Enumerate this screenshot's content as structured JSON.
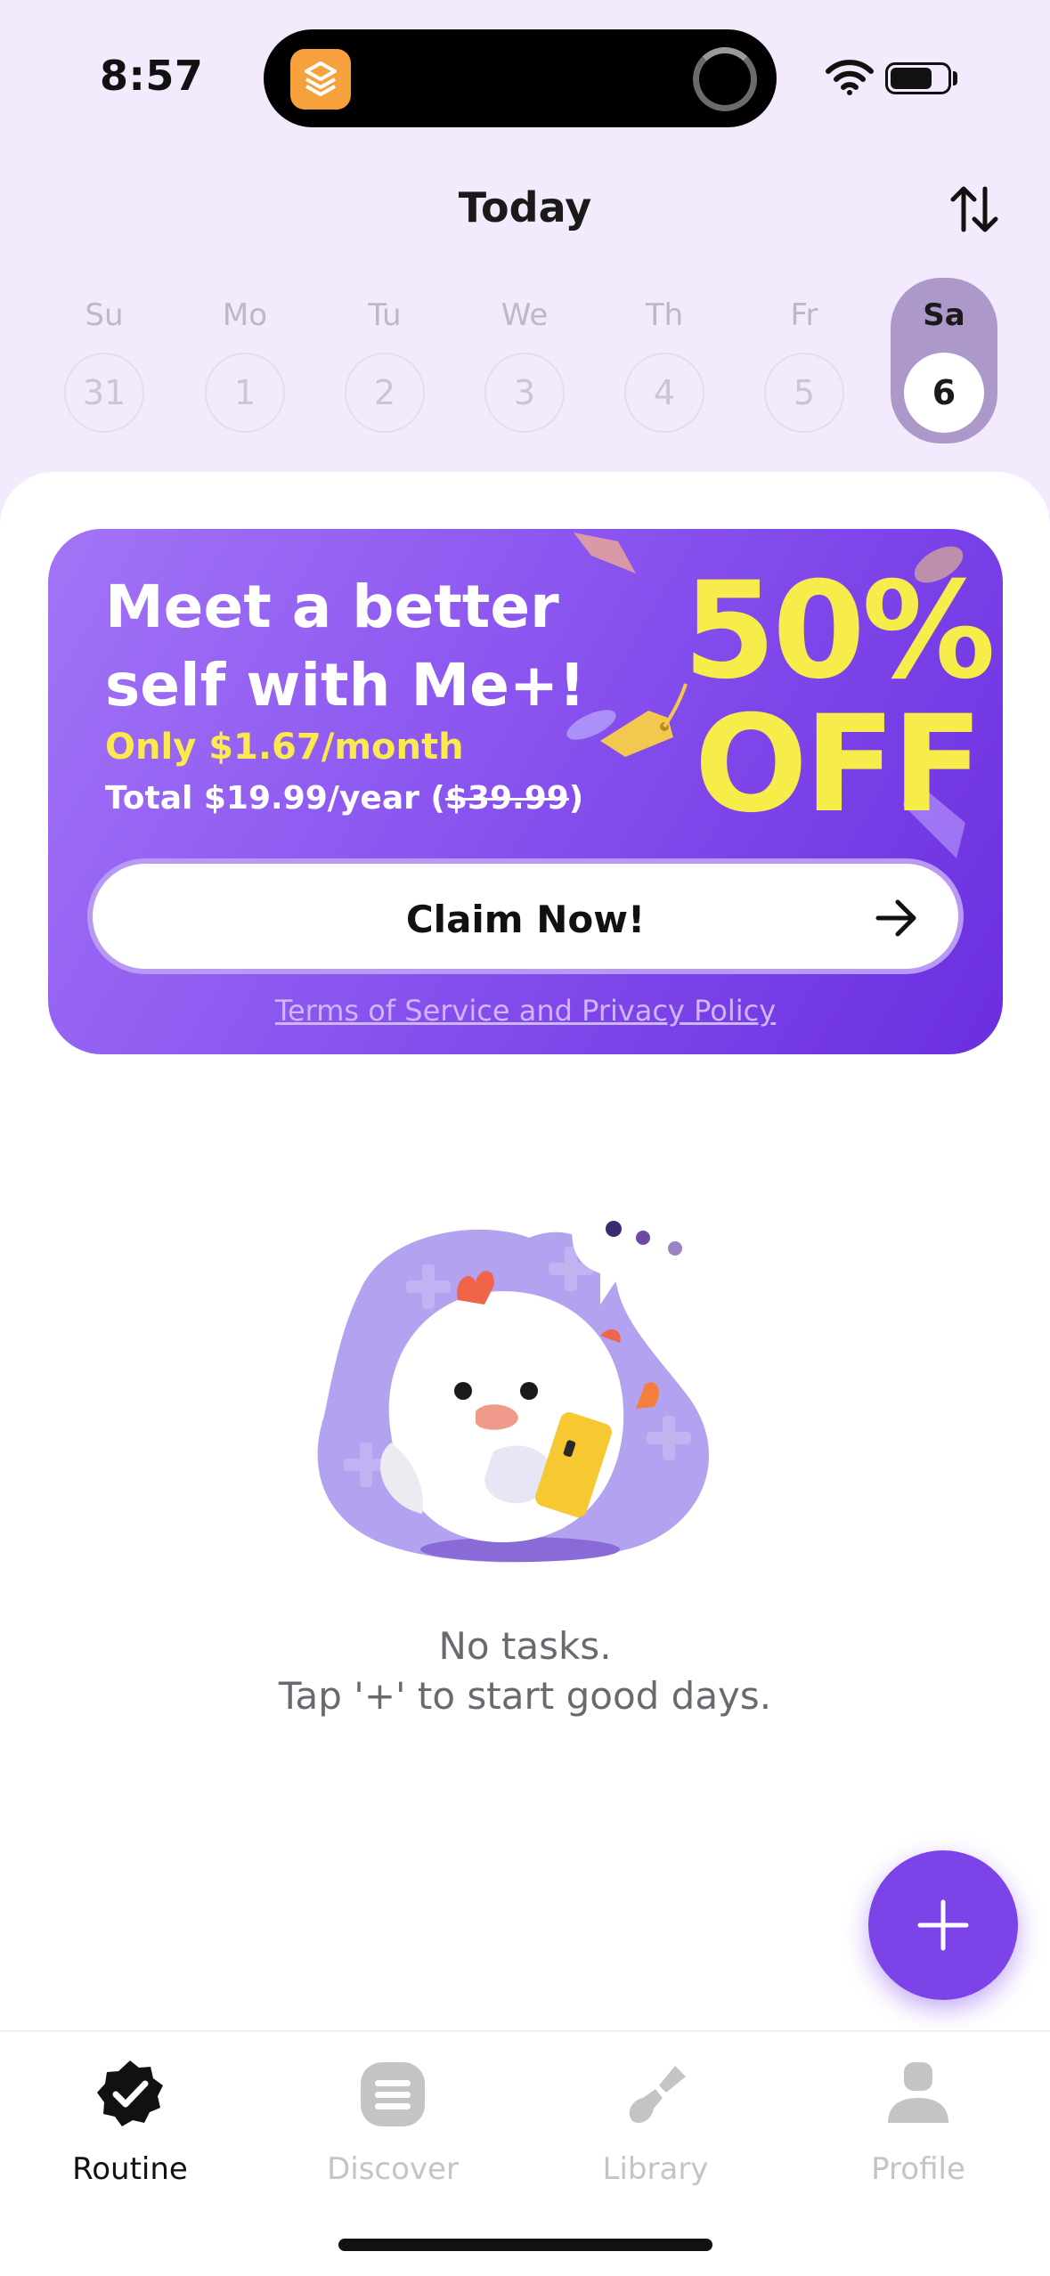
{
  "status_bar": {
    "time": "8:57"
  },
  "header": {
    "title": "Today"
  },
  "week": [
    {
      "day": "Su",
      "date": "31",
      "selected": false
    },
    {
      "day": "Mo",
      "date": "1",
      "selected": false
    },
    {
      "day": "Tu",
      "date": "2",
      "selected": false
    },
    {
      "day": "We",
      "date": "3",
      "selected": false
    },
    {
      "day": "Th",
      "date": "4",
      "selected": false
    },
    {
      "day": "Fr",
      "date": "5",
      "selected": false
    },
    {
      "day": "Sa",
      "date": "6",
      "selected": true
    }
  ],
  "promo": {
    "title": "Meet a better self with Me+!",
    "price": "Only $1.67/month",
    "total_prefix": "Total $19.99/year (",
    "total_strike": "$39.99",
    "total_suffix": ")",
    "discount_value": "50%",
    "discount_word": "OFF",
    "cta": "Claim Now!",
    "terms": "Terms of Service and Privacy Policy"
  },
  "empty_state": {
    "line1": "No tasks.",
    "line2": "Tap '+' to start good days."
  },
  "tabs": [
    {
      "label": "Routine",
      "icon": "check-badge-icon",
      "active": true
    },
    {
      "label": "Discover",
      "icon": "list-icon",
      "active": false
    },
    {
      "label": "Library",
      "icon": "brush-icon",
      "active": false
    },
    {
      "label": "Profile",
      "icon": "person-icon",
      "active": false
    }
  ],
  "colors": {
    "accent": "#7c43e8",
    "background": "#f3eafd",
    "discount_yellow": "#f6ec4a",
    "selected_day": "#ad99c9"
  }
}
